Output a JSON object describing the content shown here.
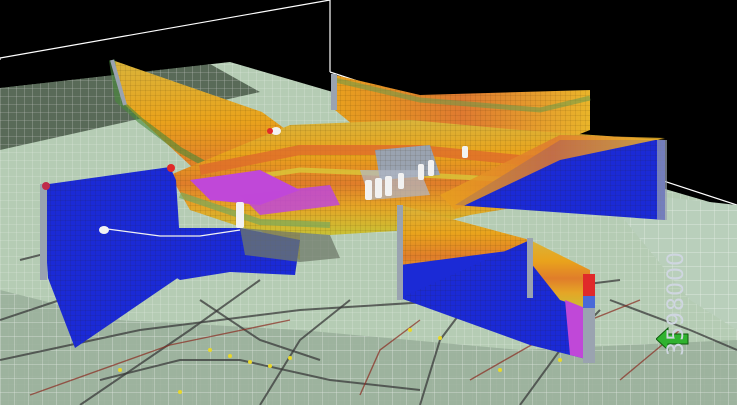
{
  "viewer": {
    "coordinate_label": "3598000",
    "north_arrow_icon": "green-arrow-icon"
  },
  "colors": {
    "background": "#000000",
    "ground": "#a9c4ab",
    "grid": "#ffffff",
    "blue_layer": "#1c2ad8",
    "orange_layer": "#e59a1a",
    "yellow_layer": "#d8d82a",
    "magenta_layer": "#c044d8",
    "red_layer": "#d86a2a",
    "grey_layer": "#9aa3b0",
    "borehole_red": "#e02a2a",
    "borehole_white": "#f2f2f2"
  }
}
